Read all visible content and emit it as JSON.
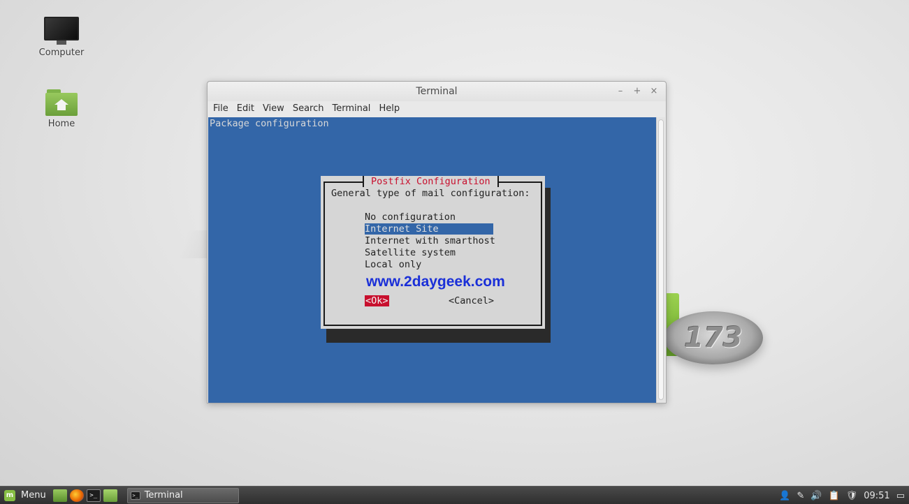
{
  "desktop": {
    "icons": [
      {
        "label": "Computer",
        "icon": "computer-icon"
      },
      {
        "label": "Home",
        "icon": "home-folder-icon"
      }
    ],
    "wallpaper_badge_text": "173"
  },
  "window": {
    "title": "Terminal",
    "controls": {
      "minimize": "–",
      "maximize": "+",
      "close": "×"
    },
    "menu": [
      "File",
      "Edit",
      "View",
      "Search",
      "Terminal",
      "Help"
    ]
  },
  "terminal": {
    "header_line": "Package configuration",
    "dialog": {
      "title": "Postfix Configuration",
      "prompt": "General type of mail configuration:",
      "options": [
        "No configuration",
        "Internet Site",
        "Internet with smarthost",
        "Satellite system",
        "Local only"
      ],
      "selected_index": 1,
      "watermark": "www.2daygeek.com",
      "ok_label": "<Ok>",
      "cancel_label": "<Cancel>"
    }
  },
  "taskbar": {
    "menu_label": "Menu",
    "launchers": [
      "show-desktop-icon",
      "firefox-icon",
      "terminal-icon",
      "files-icon"
    ],
    "task_item_label": "Terminal",
    "tray_icons": [
      "user-icon",
      "network-icon",
      "volume-icon",
      "clipboard-icon",
      "shield-icon"
    ],
    "clock": "09:51"
  }
}
